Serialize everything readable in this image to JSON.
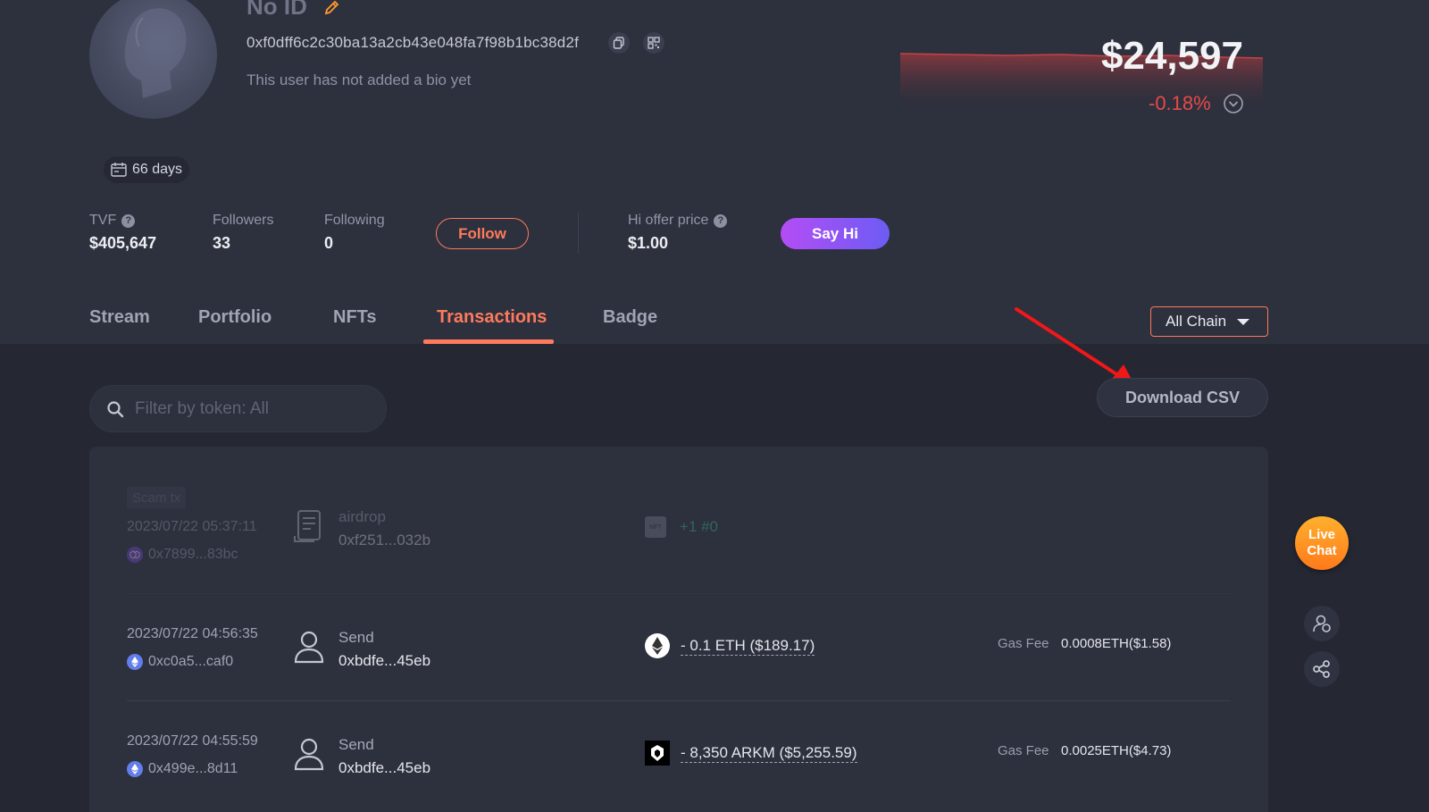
{
  "profile": {
    "username": "No ID",
    "address": "0xf0dff6c2c30ba13a2cb43e048fa7f98b1bc38d2f",
    "bio": "This user has not added a bio yet",
    "days": "66 days"
  },
  "portfolio": {
    "total_value": "$24,597",
    "change": "-0.18%",
    "chart_color": "#e64a4a"
  },
  "stats": {
    "tvf_label": "TVF",
    "tvf_value": "$405,647",
    "followers_label": "Followers",
    "followers_value": "33",
    "following_label": "Following",
    "following_value": "0",
    "follow_button": "Follow",
    "offer_label": "Hi offer price",
    "offer_value": "$1.00",
    "sayhi_button": "Say Hi"
  },
  "tabs": [
    {
      "label": "Stream"
    },
    {
      "label": "Portfolio"
    },
    {
      "label": "NFTs"
    },
    {
      "label": "Transactions"
    },
    {
      "label": "Badge"
    }
  ],
  "active_tab": "Transactions",
  "toolbar": {
    "chain_filter": "All Chain",
    "search_placeholder": "Filter by token: All",
    "download_csv": "Download CSV"
  },
  "transactions": [
    {
      "tag": "Scam tx",
      "time": "2023/07/22 05:37:11",
      "hash": "0x7899...83bc",
      "type": "airdrop",
      "counterparty": "0xf251...032b",
      "token_icon": "nft-icon",
      "amount": "+1 #0"
    },
    {
      "time": "2023/07/22 04:56:35",
      "hash": "0xc0a5...caf0",
      "type": "Send",
      "counterparty": "0xbdfe...45eb",
      "token_icon": "eth-icon",
      "amount": "- 0.1 ETH ($189.17)",
      "gas_label": "Gas Fee",
      "gas_value": "0.0008ETH($1.58)"
    },
    {
      "time": "2023/07/22 04:55:59",
      "hash": "0x499e...8d11",
      "type": "Send",
      "counterparty": "0xbdfe...45eb",
      "token_icon": "arkm-icon",
      "amount": "- 8,350 ARKM ($5,255.59)",
      "gas_label": "Gas Fee",
      "gas_value": "0.0025ETH($4.73)"
    }
  ],
  "floating": {
    "live_chat": "Live Chat"
  },
  "colors": {
    "accent": "#ff7a5c",
    "negative": "#e64a4a",
    "background": "#252833",
    "panel": "#2d303d"
  }
}
